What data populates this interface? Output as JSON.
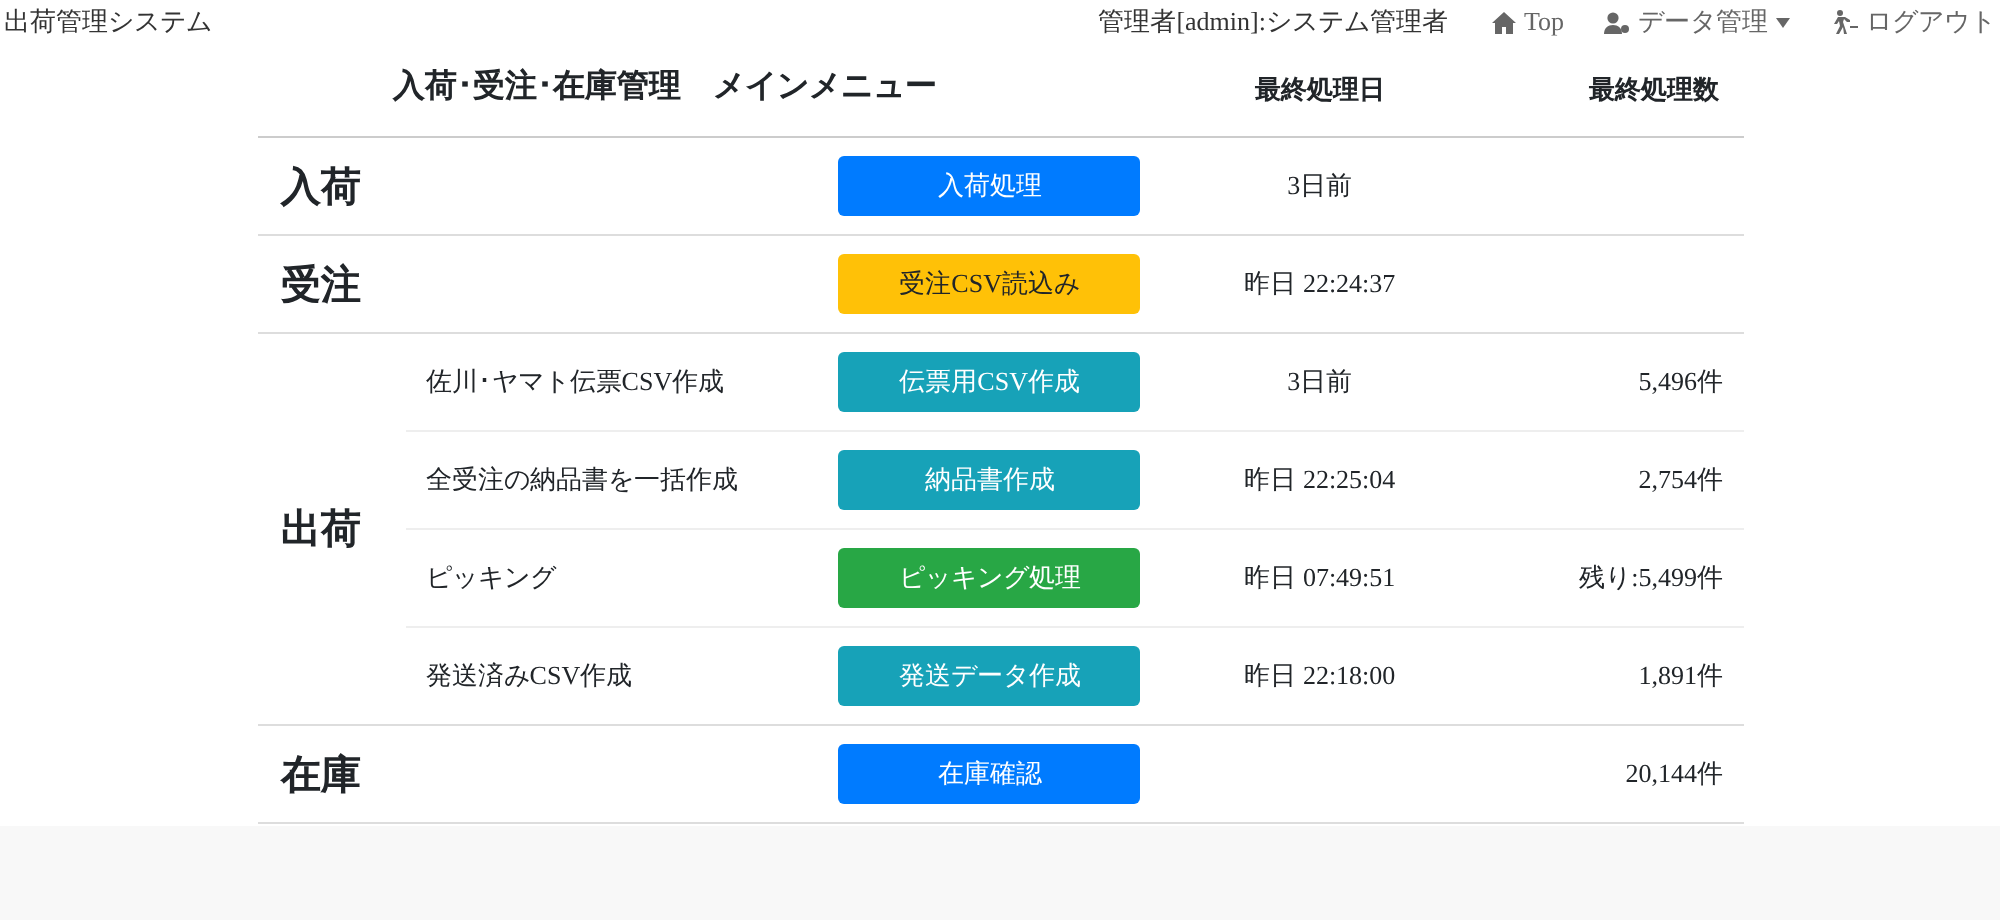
{
  "navbar": {
    "brand": "出荷管理システム",
    "user": "管理者[admin]:システム管理者",
    "links": [
      {
        "kind": "home",
        "label": "Top"
      },
      {
        "kind": "data",
        "label": "データ管理",
        "dropdown": true
      },
      {
        "kind": "logout",
        "label": "ログアウト"
      }
    ]
  },
  "table": {
    "title": "入荷･受注･在庫管理　メインメニュー",
    "columns": [
      "最終処理日",
      "最終処理数"
    ],
    "groups": [
      {
        "category": "入荷",
        "rows": [
          {
            "button": "入荷処理",
            "color": "#007bff",
            "date": "3日前"
          }
        ]
      },
      {
        "category": "受注",
        "rows": [
          {
            "button": "受注CSV読込み",
            "color": "#ffc107",
            "date": "昨日 22:24:37"
          }
        ]
      },
      {
        "category": "出荷",
        "rows": [
          {
            "task": "佐川･ヤマト伝票CSV作成",
            "button": "伝票用CSV作成",
            "color": "#17a2b8",
            "date": "3日前",
            "count": "5,496件"
          },
          {
            "task": "全受注の納品書を一括作成",
            "button": "納品書作成",
            "color": "#17a2b8",
            "date": "昨日 22:25:04",
            "count": "2,754件"
          },
          {
            "task": "ピッキング",
            "button": "ピッキング処理",
            "color": "#28a745",
            "date": "昨日 07:49:51",
            "count": "残り:5,499件"
          },
          {
            "task": "発送済みCSV作成",
            "button": "発送データ作成",
            "color": "#17a2b8",
            "date": "昨日 22:18:00",
            "count": "1,891件"
          }
        ]
      },
      {
        "category": "在庫",
        "rows": [
          {
            "button": "在庫確認",
            "color": "#007bff",
            "count": "20,144件"
          }
        ]
      }
    ]
  }
}
